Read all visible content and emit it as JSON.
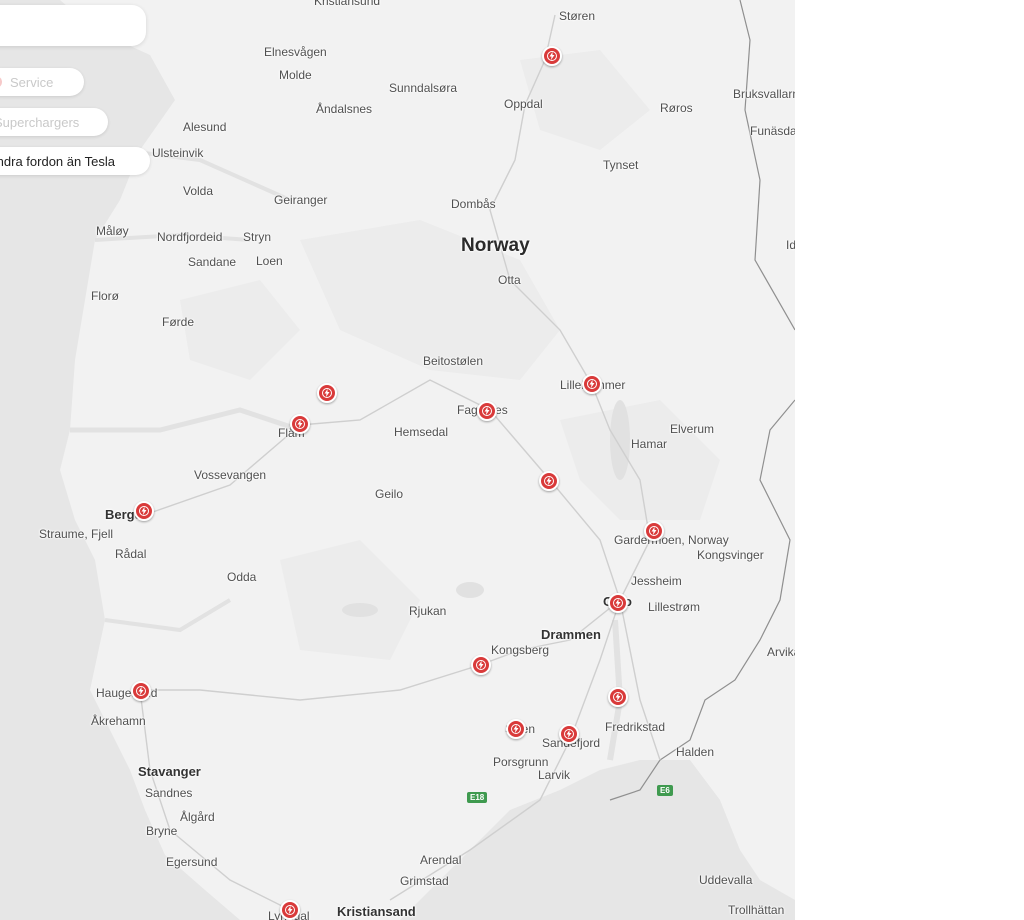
{
  "filters": {
    "service_label": "Service",
    "superchargers_label": "Superchargers",
    "other_vehicles_label": "Andra fordon än Tesla"
  },
  "map": {
    "country_label": "Norway",
    "places": [
      "Kristiansund",
      "Støren",
      "Elnesvågen",
      "Molde",
      "Sunndalsøra",
      "Oppdal",
      "Røros",
      "Bruksvallarna",
      "Åndalsnes",
      "Alesund",
      "Funäsdalen",
      "Ulsteinvik",
      "Tynset",
      "Volda",
      "Geiranger",
      "Dombås",
      "Måløy",
      "Nordfjordeid",
      "Stryn",
      "Sandane",
      "Loen",
      "Otta",
      "Florø",
      "Førde",
      "Beitostølen",
      "Lillehammer",
      "Fagernes",
      "Flåm",
      "Hemsedal",
      "Elverum",
      "Hamar",
      "Vossevangen",
      "Geilo",
      "Bergen",
      "Straume, Fjell",
      "Rådal",
      "Gardermoen, Norway",
      "Kongsvinger",
      "Odda",
      "Jessheim",
      "Oslo",
      "Lillestrøm",
      "Rjukan",
      "Drammen",
      "Kongsberg",
      "Arvika",
      "Haugesund",
      "Åkrehamn",
      "Skien",
      "Sandefjord",
      "Fredrikstad",
      "Porsgrunn",
      "Larvik",
      "Halden",
      "Stavanger",
      "Sandnes",
      "Ålgård",
      "Bryne",
      "Egersund",
      "Arendal",
      "Grimstad",
      "Uddevalla",
      "Lyngdal",
      "Kristiansand",
      "Trollhättan",
      "Idre"
    ],
    "road_shields": [
      "E18",
      "E6"
    ],
    "supercharger_count": 16,
    "colors": {
      "pin": "#d93a3a",
      "land": "#f2f2f2",
      "sea": "#e6e6e6",
      "border": "#8a8a8a"
    }
  }
}
